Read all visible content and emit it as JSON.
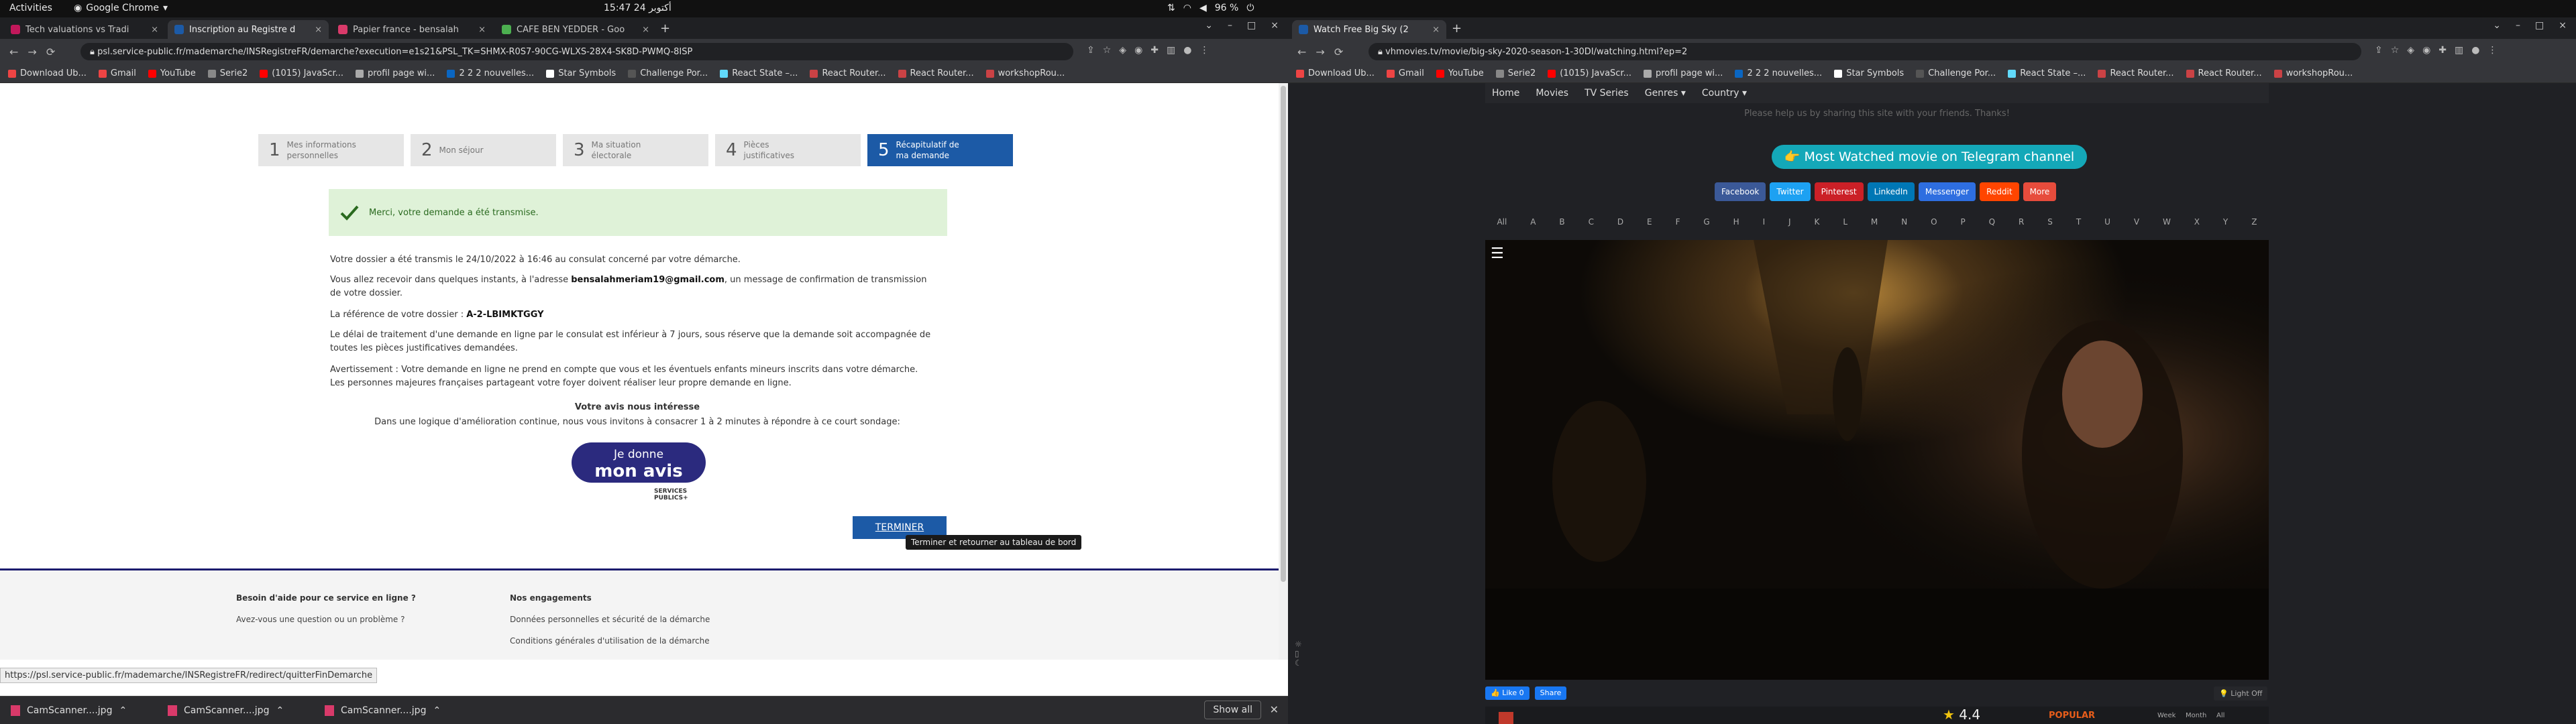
{
  "os": {
    "activities": "Activities",
    "app": "Google Chrome",
    "clock": "15:47  أكتوبر 24",
    "battery": "96 %"
  },
  "left": {
    "tabs": [
      {
        "label": "Tech valuations vs Tradi",
        "color": "#c2185b"
      },
      {
        "label": "Inscription au Registre d",
        "color": "#1c5aa6"
      },
      {
        "label": "Papier france - bensalah",
        "color": "#d93a6a"
      },
      {
        "label": "CAFE BEN YEDDER - Goo",
        "color": "#4caf50"
      }
    ],
    "url": "psl.service-public.fr/mademarche/INSRegistreFR/demarche?execution=e1s21&PSL_TK=SHMX-R0S7-90CG-WLXS-28X4-SK8D-PWMQ-8ISP",
    "bookmarks": [
      "Download Ub...",
      "Gmail",
      "YouTube",
      "Serie2",
      "(1015) JavaScr...",
      "profil page wi...",
      "2 2 2 nouvelles...",
      "Star Symbols",
      "Challenge Por...",
      "React State –...",
      "React Router...",
      "React Router...",
      "workshopRou..."
    ],
    "steps": [
      {
        "num": "1",
        "label": "Mes informations personnelles"
      },
      {
        "num": "2",
        "label": "Mon séjour"
      },
      {
        "num": "3",
        "label": "Ma situation électorale"
      },
      {
        "num": "4",
        "label": "Pièces justificatives"
      },
      {
        "num": "5",
        "label": "Récapitulatif de ma demande"
      }
    ],
    "success": "Merci, votre demande a été transmise.",
    "p1": "Votre dossier a été transmis le 24/10/2022 à 16:46 au consulat concerné par votre démarche.",
    "p2_pre": "Vous allez recevoir dans quelques instants, à l'adresse ",
    "p2_email": "bensalahmeriam19@gmail.com",
    "p2_post": ", un message de confirmation de transmission de votre dossier.",
    "p3_pre": "La référence de votre dossier : ",
    "p3_ref": "A-2-LBIMKTGGY",
    "p4": "Le délai de traitement d'une demande en ligne par le consulat est inférieur à 7 jours, sous réserve que la demande soit accompagnée de toutes les pièces justificatives demandées.",
    "p5": "Avertissement : Votre demande en ligne ne prend en compte que vous et les éventuels enfants mineurs inscrits dans votre démarche. Les personnes majeures françaises partageant votre foyer doivent réaliser leur propre demande en ligne.",
    "avis_title": "Votre avis nous intéresse",
    "avis_text": "Dans une logique d'amélioration continue, nous vous invitons à consacrer 1 à 2 minutes à répondre à ce court sondage:",
    "avis_btn_1": "Je donne",
    "avis_btn_2": "mon avis",
    "services": "SERVICES PUBLICS+",
    "terminer": "TERMINER",
    "tooltip": "Terminer et retourner au tableau de bord",
    "footer": {
      "h1": "Besoin d'aide pour ce service en ligne ?",
      "l1": "Avez-vous une question ou un problème ?",
      "h2": "Nos engagements",
      "l2": "Données personnelles et sécurité de la démarche",
      "l3": "Conditions générales d'utilisation de la démarche"
    },
    "status_url": "https://psl.service-public.fr/mademarche/INSRegistreFR/redirect/quitterFinDemarche",
    "downloads": [
      "CamScanner....jpg",
      "CamScanner....jpg",
      "CamScanner....jpg"
    ],
    "show_all": "Show all"
  },
  "right": {
    "tab": "Watch Free Big Sky (2",
    "url": "vhmovies.tv/movie/big-sky-2020-season-1-30DI/watching.html?ep=2",
    "bookmarks": [
      "Download Ub...",
      "Gmail",
      "YouTube",
      "Serie2",
      "(1015) JavaScr...",
      "profil page wi...",
      "2 2 2 nouvelles...",
      "Star Symbols",
      "Challenge Por...",
      "React State –...",
      "React Router...",
      "React Router...",
      "workshopRou..."
    ],
    "nav": [
      "Home",
      "Movies",
      "TV Series",
      "Genres ▾",
      "Country ▾"
    ],
    "share_text": "Please help us by sharing this site with your friends. Thanks!",
    "telegram": "👉 Most Watched movie on Telegram channel",
    "social": [
      {
        "label": "Facebook",
        "color": "#3b5998"
      },
      {
        "label": "Twitter",
        "color": "#1da1f2"
      },
      {
        "label": "Pinterest",
        "color": "#cb2027"
      },
      {
        "label": "LinkedIn",
        "color": "#0077b5"
      },
      {
        "label": "Messenger",
        "color": "#2e6ee0"
      },
      {
        "label": "Reddit",
        "color": "#ff4500"
      },
      {
        "label": "More",
        "color": "#e74c3c"
      }
    ],
    "alpha": [
      "All",
      "A",
      "B",
      "C",
      "D",
      "E",
      "F",
      "G",
      "H",
      "I",
      "J",
      "K",
      "L",
      "M",
      "N",
      "O",
      "P",
      "Q",
      "R",
      "S",
      "T",
      "U",
      "V",
      "W",
      "X",
      "Y",
      "Z"
    ],
    "fb_like": "👍 Like 0",
    "fb_share": "Share",
    "light_off": "💡 Light Off",
    "rating": "4.4",
    "popular": "POPULAR",
    "week": "Week",
    "month": "Month",
    "all": "All"
  }
}
